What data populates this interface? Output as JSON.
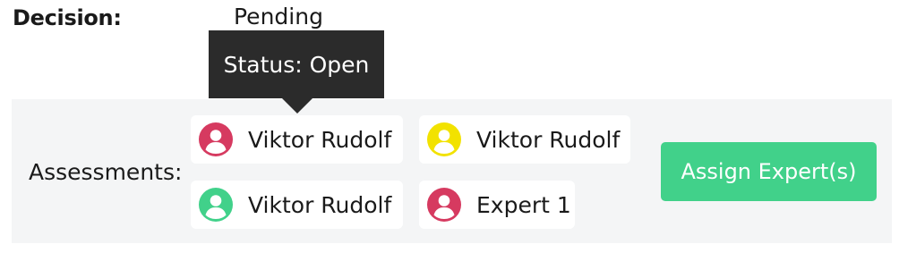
{
  "decision": {
    "label": "Decision:",
    "value": "Pending"
  },
  "tooltip": {
    "text": "Status: Open"
  },
  "assessments": {
    "label": "Assessments:",
    "experts": [
      {
        "name": "Viktor Rudolf",
        "icon": "user-avatar-icon",
        "status_color": "#d63a60"
      },
      {
        "name": "Viktor Rudolf",
        "icon": "user-avatar-icon",
        "status_color": "#f2e200"
      },
      {
        "name": "Viktor Rudolf",
        "icon": "user-avatar-icon",
        "status_color": "#41d18a"
      },
      {
        "name": "Expert 1",
        "icon": "user-avatar-icon",
        "status_color": "#d63a60"
      }
    ]
  },
  "assign_button": {
    "label": "Assign Expert(s)",
    "color": "#41d18a"
  }
}
